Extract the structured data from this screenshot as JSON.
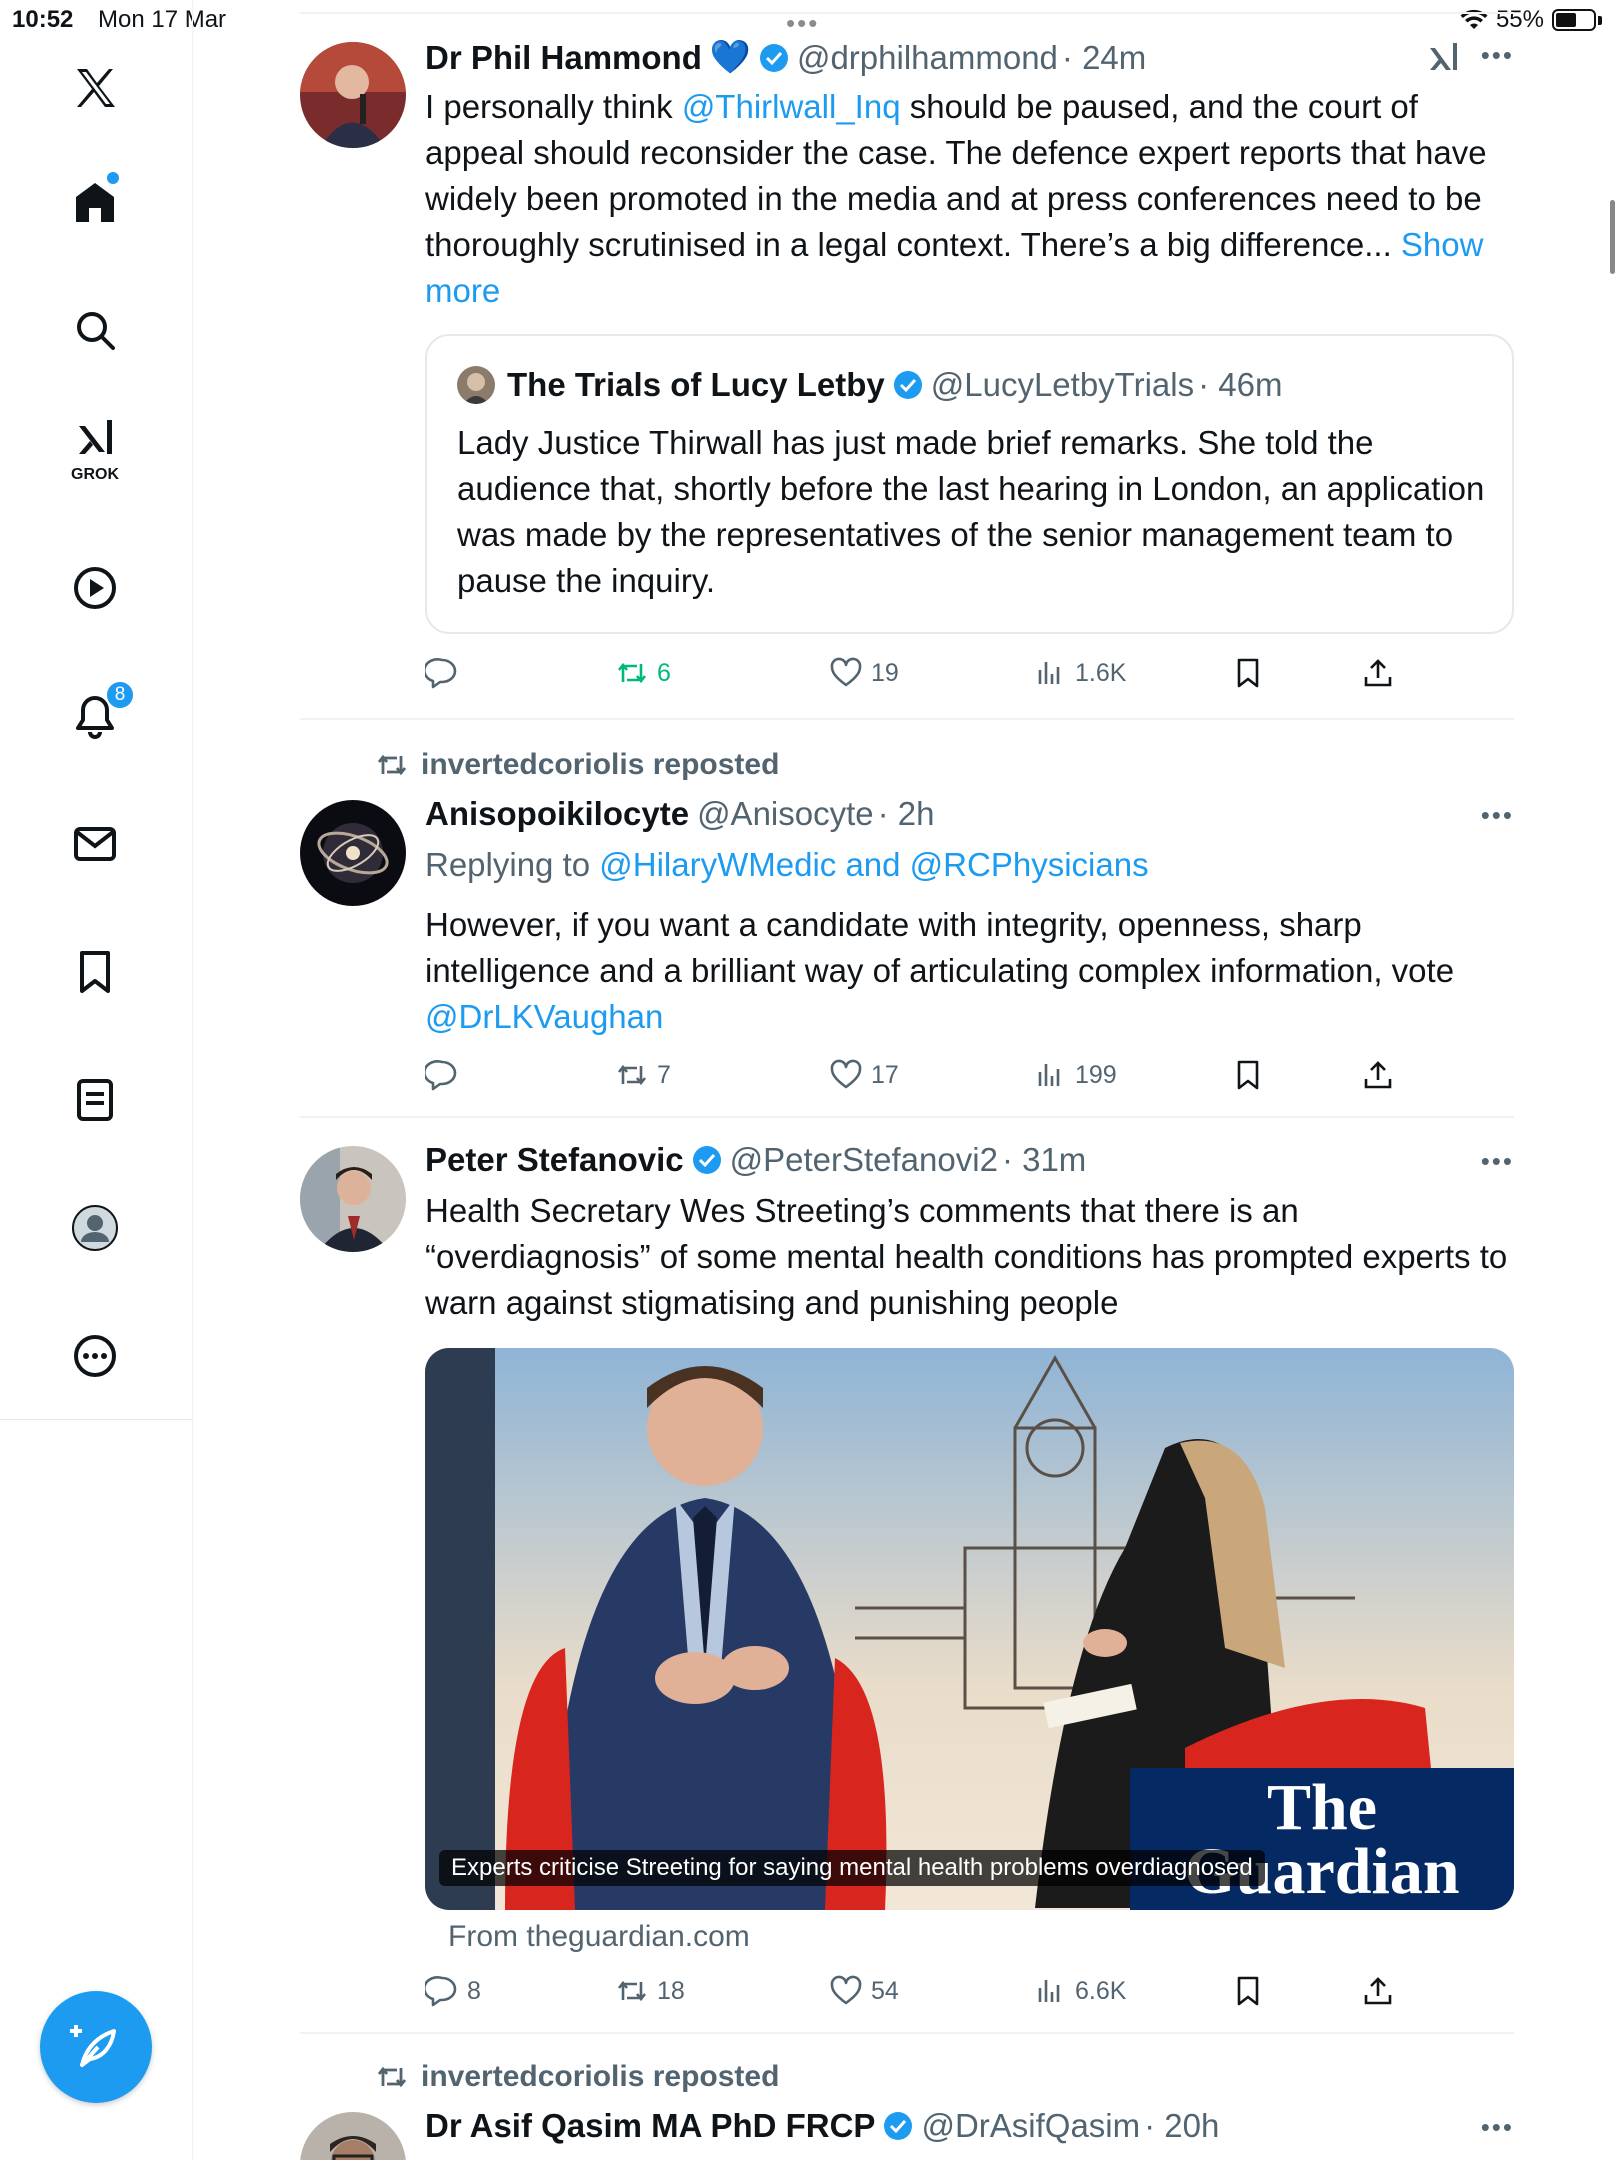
{
  "status_bar": {
    "time": "10:52",
    "date": "Mon 17 Mar",
    "battery": "55%",
    "battery_level": 0.55
  },
  "sidebar": {
    "items": [
      {
        "name": "x-logo",
        "icon": "x-logo-icon"
      },
      {
        "name": "home",
        "icon": "home-icon",
        "has_dot": true
      },
      {
        "name": "search",
        "icon": "search-icon"
      },
      {
        "name": "grok",
        "icon": "grok-icon",
        "label": "GROK"
      },
      {
        "name": "video",
        "icon": "play-icon"
      },
      {
        "name": "notifications",
        "icon": "bell-icon",
        "badge": "8"
      },
      {
        "name": "messages",
        "icon": "mail-icon"
      },
      {
        "name": "bookmarks",
        "icon": "bookmark-icon"
      },
      {
        "name": "lists",
        "icon": "list-icon"
      },
      {
        "name": "profile",
        "icon": "avatar-icon"
      },
      {
        "name": "more",
        "icon": "more-circle-icon"
      }
    ],
    "compose_icon": "compose-feather-icon"
  },
  "posts": [
    {
      "name": "Dr Phil Hammond",
      "emoji": "💙",
      "handle": "@drphilhammond",
      "time": "· 24m",
      "text_pre": "I personally think ",
      "mention": "@Thirlwall_Inq",
      "text_post": " should be paused, and the court of appeal should reconsider the case. The defence expert reports that have widely been promoted in the media and at press conferences need to be thoroughly scrutinised in a legal context. There’s a big difference... ",
      "show_more": "Show more",
      "quote": {
        "name": "The Trials of Lucy Letby",
        "handle": "@LucyLetbyTrials",
        "time": "· 46m",
        "text": "Lady Justice Thirwall has just made brief remarks. She told the audience that, shortly before the last hearing in London, an application was made by the representatives of the senior management team to pause the inquiry."
      },
      "actions": {
        "replies": "",
        "reposts": "6",
        "likes": "19",
        "views": "1.6K"
      }
    },
    {
      "reposted_by": "invertedcoriolis reposted",
      "name": "Anisopoikilocyte",
      "handle": "@Anisocyte",
      "time": "· 2h",
      "replying_prefix": "Replying to ",
      "replying_to": "@HilaryWMedic and @RCPhysicians",
      "text": "However, if you want a candidate with integrity, openness, sharp intelligence and a brilliant way of articulating complex information, vote ",
      "mention": "@DrLKVaughan",
      "actions": {
        "replies": "",
        "reposts": "7",
        "likes": "17",
        "views": "199"
      }
    },
    {
      "name": "Peter Stefanovic",
      "handle": "@PeterStefanovi2",
      "time": "· 31m",
      "text": "Health Secretary Wes Streeting’s comments that there is an “overdiagnosis” of some mental health conditions has prompted experts to warn against stigmatising and punishing people",
      "card": {
        "caption": "Experts criticise Streeting for saying mental health problems overdiagnosed",
        "logo_line1": "The",
        "logo_line2": "Guardian",
        "from": "From theguardian.com"
      },
      "actions": {
        "replies": "8",
        "reposts": "18",
        "likes": "54",
        "views": "6.6K"
      }
    },
    {
      "reposted_by": "invertedcoriolis reposted",
      "name": "Dr Asif Qasim MA PhD FRCP",
      "handle": "@DrAsifQasim",
      "time": "· 20h"
    }
  ],
  "colors": {
    "accent": "#1d9bf0",
    "text": "#0f1419",
    "muted": "#536471",
    "repost_green": "#00ba7c",
    "guardian_blue": "#052962"
  }
}
